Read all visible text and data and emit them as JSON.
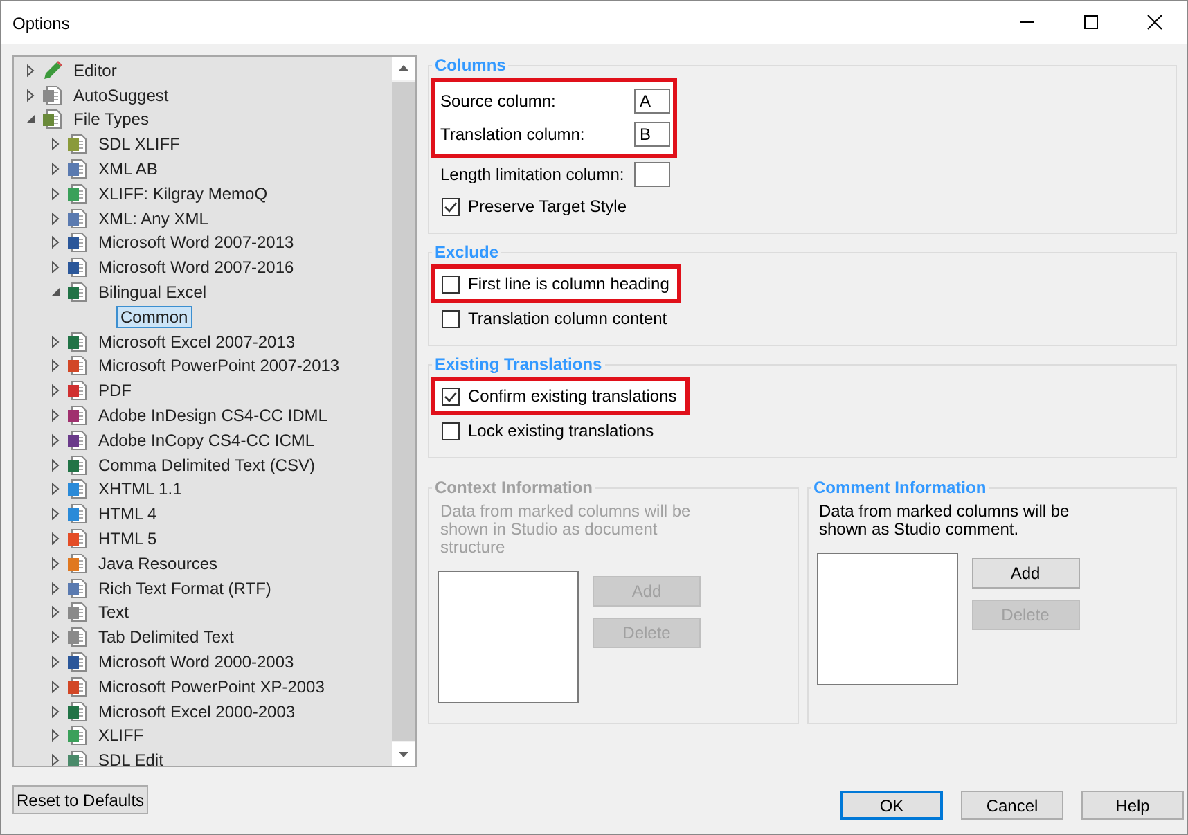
{
  "window": {
    "title": "Options"
  },
  "tree": [
    {
      "label": "Editor",
      "kind": "pencil",
      "expanded": false,
      "selected": false
    },
    {
      "label": "AutoSuggest",
      "kind": "suggest",
      "expanded": false,
      "selected": false
    },
    {
      "label": "File Types",
      "kind": "filetypes",
      "expanded": true,
      "selected": false,
      "children": [
        {
          "label": "SDL XLIFF",
          "kind": "sdlxliff",
          "expanded": false,
          "selected": false
        },
        {
          "label": "XML AB",
          "kind": "xml",
          "expanded": false,
          "selected": false
        },
        {
          "label": "XLIFF: Kilgray MemoQ",
          "kind": "xliff",
          "expanded": false,
          "selected": false
        },
        {
          "label": "XML: Any XML",
          "kind": "xml",
          "expanded": false,
          "selected": false
        },
        {
          "label": "Microsoft Word 2007-2013",
          "kind": "word",
          "expanded": false,
          "selected": false
        },
        {
          "label": "Microsoft Word 2007-2016",
          "kind": "word",
          "expanded": false,
          "selected": false
        },
        {
          "label": "Bilingual Excel",
          "kind": "excel",
          "expanded": true,
          "selected": false,
          "children": [
            {
              "label": "Common",
              "selected": true
            }
          ]
        },
        {
          "label": "Microsoft Excel 2007-2013",
          "kind": "excel",
          "expanded": false,
          "selected": false
        },
        {
          "label": "Microsoft PowerPoint 2007-2013",
          "kind": "powerpoint",
          "expanded": false,
          "selected": false
        },
        {
          "label": "PDF",
          "kind": "pdf",
          "expanded": false,
          "selected": false
        },
        {
          "label": "Adobe InDesign CS4-CC IDML",
          "kind": "indesign",
          "expanded": false,
          "selected": false
        },
        {
          "label": "Adobe InCopy CS4-CC ICML",
          "kind": "incopy",
          "expanded": false,
          "selected": false
        },
        {
          "label": "Comma Delimited Text (CSV)",
          "kind": "excel",
          "expanded": false,
          "selected": false
        },
        {
          "label": "XHTML 1.1",
          "kind": "globe",
          "expanded": false,
          "selected": false
        },
        {
          "label": "HTML 4",
          "kind": "globe",
          "expanded": false,
          "selected": false
        },
        {
          "label": "HTML 5",
          "kind": "html5",
          "expanded": false,
          "selected": false
        },
        {
          "label": "Java Resources",
          "kind": "java",
          "expanded": false,
          "selected": false
        },
        {
          "label": "Rich Text Format (RTF)",
          "kind": "rtf",
          "expanded": false,
          "selected": false
        },
        {
          "label": "Text",
          "kind": "text",
          "expanded": false,
          "selected": false
        },
        {
          "label": "Tab Delimited Text",
          "kind": "text",
          "expanded": false,
          "selected": false
        },
        {
          "label": "Microsoft Word 2000-2003",
          "kind": "word",
          "expanded": false,
          "selected": false
        },
        {
          "label": "Microsoft PowerPoint XP-2003",
          "kind": "powerpoint",
          "expanded": false,
          "selected": false
        },
        {
          "label": "Microsoft Excel 2000-2003",
          "kind": "excel",
          "expanded": false,
          "selected": false
        },
        {
          "label": "XLIFF",
          "kind": "xliff",
          "expanded": false,
          "selected": false
        },
        {
          "label": "SDL Edit",
          "kind": "sdledit",
          "expanded": false,
          "selected": false
        }
      ]
    }
  ],
  "columns": {
    "title": "Columns",
    "fields": [
      {
        "label": "Source column:",
        "value": "A",
        "highlighted": true
      },
      {
        "label": "Translation column:",
        "value": "B",
        "highlighted": true
      },
      {
        "label": "Length limitation column:",
        "highlighted": false
      }
    ],
    "options": [
      {
        "label": "Preserve Target Style",
        "checked": true,
        "highlighted": false
      }
    ]
  },
  "exclude": {
    "title": "Exclude",
    "options": [
      {
        "label": "First line is column heading",
        "checked": false,
        "highlighted": true
      },
      {
        "label": "Translation column content",
        "checked": false,
        "highlighted": false
      }
    ]
  },
  "existing_translations": {
    "title": "Existing Translations",
    "options": [
      {
        "label": "Confirm existing translations",
        "checked": true,
        "highlighted": true
      },
      {
        "label": "Lock existing translations",
        "checked": false,
        "highlighted": false
      }
    ]
  },
  "info_groups": [
    {
      "title": "Context Information",
      "disabled": true,
      "description": "Data from marked columns will be shown in Studio as document structure",
      "buttons": [
        {
          "label": "Add",
          "disabled": true
        },
        {
          "label": "Delete",
          "disabled": true
        }
      ]
    },
    {
      "title": "Comment Information",
      "disabled": false,
      "description": "Data from marked columns will be shown as Studio comment.",
      "buttons": [
        {
          "label": "Add",
          "disabled": false
        },
        {
          "label": "Delete",
          "disabled": true
        }
      ]
    }
  ],
  "reset_button": "Reset to Defaults",
  "dialog_buttons": [
    {
      "label": "OK",
      "default": true
    },
    {
      "label": "Cancel",
      "default": false
    },
    {
      "label": "Help",
      "default": false
    }
  ]
}
